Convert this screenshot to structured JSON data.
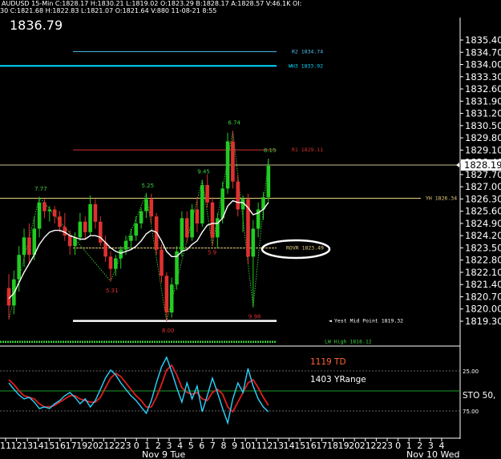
{
  "header": {
    "title_line": "AUDUSD 15-Min C:1828.17 H:1830.21 L:1819.02 O:1823.29 B:1828.17 A:1828.57 V:46.1K OI:",
    "sub_line": "30 C:1821.68 H:1822.83 L:1821.07 O:1821.64 V:880 11-08-21 8:55",
    "current_price": "1836.79"
  },
  "price_marker": "1828.19",
  "levels": [
    {
      "id": "r2",
      "label": "R2 1834.74",
      "value": 1834.74,
      "color": "#4fc3f7"
    },
    {
      "id": "wh3",
      "label": "WH3 1833.92",
      "value": 1833.92,
      "color": "#00d8ff"
    },
    {
      "id": "r1",
      "label": "R1 1829.11",
      "value": 1829.11,
      "color": "#d43030"
    },
    {
      "id": "yh",
      "label": "YH 1826.34",
      "value": 1826.34,
      "color": "#e8d080"
    },
    {
      "id": "rovr",
      "label": "ROVR 1823.49",
      "value": 1823.49,
      "color": "#e8d080"
    },
    {
      "id": "ymid",
      "label": "Yest Mid Point 1819.32",
      "value": 1819.32,
      "color": "#ffffff"
    },
    {
      "id": "lwh",
      "label": "LW High 1818.12",
      "value": 1818.12,
      "color": "#3cd03c"
    }
  ],
  "swing_labels": [
    "7.77",
    "5.25",
    "9.45",
    "6.74",
    "8.15",
    "5.31",
    "8.00",
    "5.9",
    "9.98"
  ],
  "stoch": {
    "td_label": "1119 TD",
    "range_label": "1403 YRange",
    "sto_label": "STO 50,",
    "y_levels": [
      "25.00",
      "75.00"
    ]
  },
  "colors": {
    "background": "#000000",
    "up_candle": "#22cc22",
    "down_candle": "#e03030",
    "moving_average": "#ffffff",
    "stoch_k": "#2ad4ff",
    "stoch_d": "#e02020",
    "accent_td": "#ff6633"
  },
  "chart_data": {
    "type": "candlestick",
    "symbol": "AUDUSD",
    "interval": "15-Min",
    "y_ticks": [
      "1835.40",
      "1834.70",
      "1834.00",
      "1833.30",
      "1832.60",
      "1831.90",
      "1831.20",
      "1830.50",
      "1829.80",
      "1829.10",
      "1828.40",
      "1827.70",
      "1827.00",
      "1826.30",
      "1825.60",
      "1824.90",
      "1824.20",
      "1823.50",
      "1822.80",
      "1822.10",
      "1821.40",
      "1820.70",
      "1820.00",
      "1819.30"
    ],
    "ylim": [
      1818.1,
      1836.6
    ],
    "x_ticks": [
      "11",
      "12",
      "13",
      "14",
      "15",
      "16",
      "17",
      "19",
      "20",
      "21",
      "22",
      "23",
      "0",
      "1",
      "2",
      "3",
      "4",
      "5",
      "6",
      "7",
      "8",
      "9",
      "10",
      "11",
      "12",
      "13",
      "14",
      "15",
      "16",
      "17",
      "18",
      "19",
      "20",
      "21",
      "22",
      "23",
      "0",
      "1",
      "2",
      "3",
      "4"
    ],
    "x_dates": [
      "Nov 9 Tue",
      "Nov 10 Wed"
    ],
    "candles": [
      {
        "o": 1821.2,
        "h": 1822.0,
        "l": 1819.4,
        "c": 1820.2
      },
      {
        "o": 1820.2,
        "h": 1822.2,
        "l": 1819.7,
        "c": 1821.7
      },
      {
        "o": 1821.7,
        "h": 1823.6,
        "l": 1821.0,
        "c": 1823.1
      },
      {
        "o": 1823.1,
        "h": 1824.6,
        "l": 1822.4,
        "c": 1824.1
      },
      {
        "o": 1824.1,
        "h": 1824.9,
        "l": 1822.6,
        "c": 1823.1
      },
      {
        "o": 1823.1,
        "h": 1825.3,
        "l": 1822.8,
        "c": 1824.6
      },
      {
        "o": 1824.6,
        "h": 1826.4,
        "l": 1824.1,
        "c": 1826.1
      },
      {
        "o": 1826.1,
        "h": 1826.3,
        "l": 1825.2,
        "c": 1825.6
      },
      {
        "o": 1825.6,
        "h": 1825.9,
        "l": 1825.0,
        "c": 1825.7
      },
      {
        "o": 1825.7,
        "h": 1825.9,
        "l": 1824.9,
        "c": 1825.3
      },
      {
        "o": 1825.3,
        "h": 1825.6,
        "l": 1824.4,
        "c": 1824.7
      },
      {
        "o": 1824.7,
        "h": 1825.5,
        "l": 1823.9,
        "c": 1824.2
      },
      {
        "o": 1824.2,
        "h": 1824.5,
        "l": 1823.1,
        "c": 1823.6
      },
      {
        "o": 1823.6,
        "h": 1824.4,
        "l": 1823.1,
        "c": 1824.1
      },
      {
        "o": 1824.1,
        "h": 1825.5,
        "l": 1823.9,
        "c": 1825.0
      },
      {
        "o": 1825.0,
        "h": 1825.3,
        "l": 1824.0,
        "c": 1824.4
      },
      {
        "o": 1824.4,
        "h": 1826.5,
        "l": 1824.2,
        "c": 1826.0
      },
      {
        "o": 1826.0,
        "h": 1826.3,
        "l": 1824.6,
        "c": 1825.0
      },
      {
        "o": 1825.0,
        "h": 1825.3,
        "l": 1823.6,
        "c": 1823.8
      },
      {
        "o": 1823.8,
        "h": 1824.2,
        "l": 1822.7,
        "c": 1823.0
      },
      {
        "o": 1823.0,
        "h": 1823.3,
        "l": 1821.6,
        "c": 1822.3
      },
      {
        "o": 1822.3,
        "h": 1823.1,
        "l": 1821.9,
        "c": 1822.9
      },
      {
        "o": 1822.9,
        "h": 1823.6,
        "l": 1822.3,
        "c": 1823.4
      },
      {
        "o": 1823.4,
        "h": 1824.2,
        "l": 1823.1,
        "c": 1823.9
      },
      {
        "o": 1823.9,
        "h": 1824.6,
        "l": 1823.4,
        "c": 1824.2
      },
      {
        "o": 1824.2,
        "h": 1825.3,
        "l": 1823.9,
        "c": 1824.9
      },
      {
        "o": 1824.9,
        "h": 1825.8,
        "l": 1824.6,
        "c": 1825.6
      },
      {
        "o": 1825.6,
        "h": 1826.6,
        "l": 1825.2,
        "c": 1826.3
      },
      {
        "o": 1826.3,
        "h": 1826.6,
        "l": 1824.9,
        "c": 1825.3
      },
      {
        "o": 1825.3,
        "h": 1825.5,
        "l": 1823.1,
        "c": 1823.4
      },
      {
        "o": 1823.4,
        "h": 1823.7,
        "l": 1821.5,
        "c": 1821.9
      },
      {
        "o": 1821.9,
        "h": 1822.1,
        "l": 1819.3,
        "c": 1819.8
      },
      {
        "o": 1819.8,
        "h": 1821.8,
        "l": 1819.5,
        "c": 1821.4
      },
      {
        "o": 1821.4,
        "h": 1823.6,
        "l": 1821.1,
        "c": 1823.3
      },
      {
        "o": 1823.3,
        "h": 1825.6,
        "l": 1823.0,
        "c": 1825.2
      },
      {
        "o": 1825.2,
        "h": 1825.6,
        "l": 1823.8,
        "c": 1824.1
      },
      {
        "o": 1824.1,
        "h": 1826.0,
        "l": 1823.9,
        "c": 1825.7
      },
      {
        "o": 1825.7,
        "h": 1826.4,
        "l": 1824.4,
        "c": 1824.9
      },
      {
        "o": 1824.9,
        "h": 1827.4,
        "l": 1824.7,
        "c": 1827.1
      },
      {
        "o": 1827.1,
        "h": 1827.7,
        "l": 1825.8,
        "c": 1826.1
      },
      {
        "o": 1826.1,
        "h": 1826.4,
        "l": 1823.6,
        "c": 1824.1
      },
      {
        "o": 1824.1,
        "h": 1825.5,
        "l": 1823.5,
        "c": 1825.2
      },
      {
        "o": 1825.2,
        "h": 1827.3,
        "l": 1824.9,
        "c": 1826.9
      },
      {
        "o": 1826.9,
        "h": 1830.1,
        "l": 1826.6,
        "c": 1829.6
      },
      {
        "o": 1829.6,
        "h": 1830.2,
        "l": 1826.9,
        "c": 1827.3
      },
      {
        "o": 1827.3,
        "h": 1827.7,
        "l": 1825.3,
        "c": 1825.7
      },
      {
        "o": 1825.7,
        "h": 1826.5,
        "l": 1824.4,
        "c": 1826.3
      },
      {
        "o": 1826.3,
        "h": 1826.6,
        "l": 1822.6,
        "c": 1823.0
      },
      {
        "o": 1823.0,
        "h": 1825.1,
        "l": 1820.1,
        "c": 1824.6
      },
      {
        "o": 1824.6,
        "h": 1826.1,
        "l": 1824.1,
        "c": 1825.7
      },
      {
        "o": 1825.7,
        "h": 1826.7,
        "l": 1825.1,
        "c": 1826.4
      },
      {
        "o": 1826.4,
        "h": 1828.6,
        "l": 1826.1,
        "c": 1828.2
      }
    ],
    "ma": [
      1820.6,
      1820.9,
      1821.5,
      1822.1,
      1822.6,
      1823.1,
      1823.7,
      1824.1,
      1824.4,
      1824.5,
      1824.5,
      1824.4,
      1824.2,
      1824.1,
      1824.0,
      1824.0,
      1824.2,
      1824.2,
      1824.1,
      1823.8,
      1823.5,
      1823.3,
      1823.2,
      1823.3,
      1823.4,
      1823.6,
      1823.9,
      1824.3,
      1824.5,
      1824.4,
      1823.9,
      1823.3,
      1823.0,
      1823.0,
      1823.3,
      1823.4,
      1823.7,
      1823.9,
      1824.4,
      1824.8,
      1824.9,
      1824.9,
      1825.2,
      1825.9,
      1826.2,
      1826.1,
      1826.1,
      1825.8,
      1825.4,
      1825.5,
      1825.7,
      1826.1
    ],
    "stoch_k": [
      40,
      48,
      55,
      60,
      58,
      64,
      72,
      70,
      72,
      66,
      62,
      56,
      52,
      58,
      66,
      60,
      70,
      62,
      48,
      34,
      24,
      30,
      40,
      48,
      56,
      62,
      70,
      78,
      62,
      40,
      20,
      8,
      26,
      46,
      64,
      40,
      60,
      44,
      76,
      56,
      34,
      52,
      72,
      90,
      60,
      40,
      52,
      22,
      44,
      60,
      70,
      76
    ],
    "stoch_d": [
      36,
      42,
      50,
      56,
      58,
      60,
      66,
      70,
      70,
      68,
      64,
      60,
      56,
      56,
      60,
      62,
      64,
      64,
      58,
      46,
      34,
      28,
      32,
      40,
      48,
      56,
      62,
      70,
      70,
      58,
      42,
      24,
      18,
      30,
      46,
      52,
      54,
      52,
      60,
      62,
      52,
      48,
      54,
      70,
      76,
      64,
      52,
      40,
      36,
      46,
      58,
      68
    ]
  }
}
